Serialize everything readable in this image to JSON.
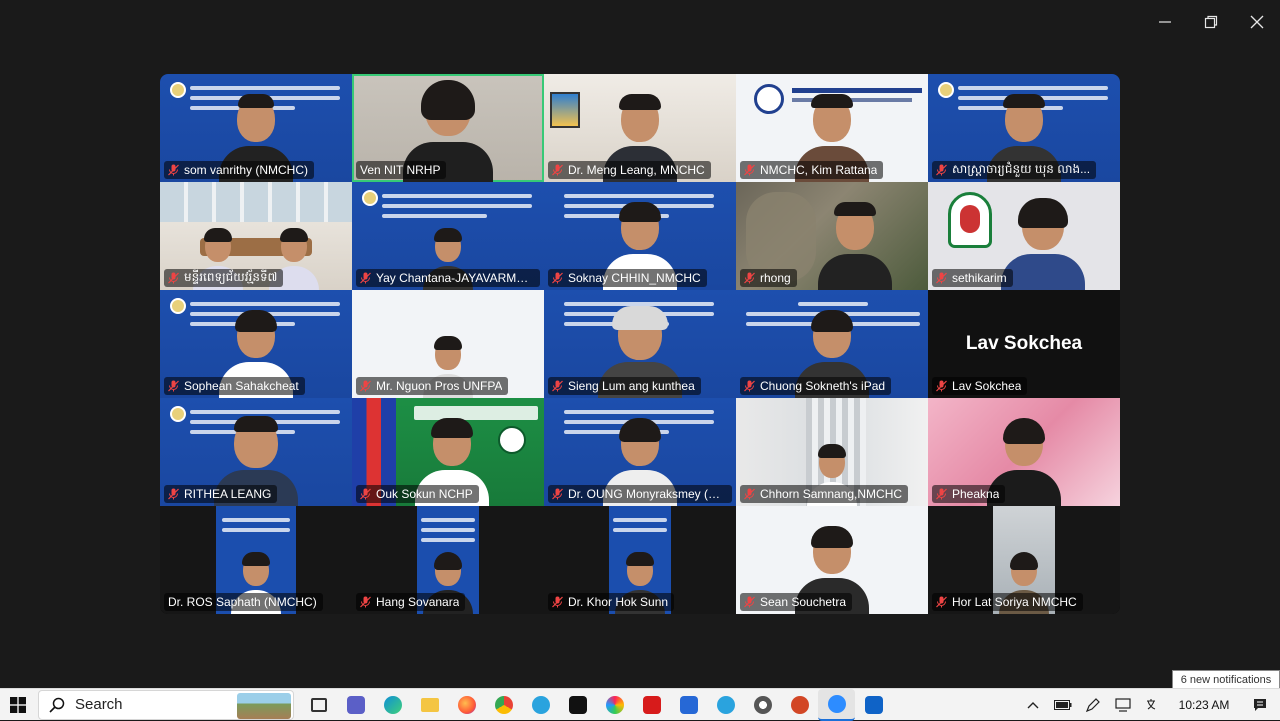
{
  "window": {
    "controls": [
      "minimize",
      "maximize",
      "close"
    ]
  },
  "participants": [
    {
      "name": "som vanrithy (NMCHC)",
      "muted": true,
      "bg": "blue"
    },
    {
      "name": "Ven NIT NRHP",
      "muted": false,
      "bg": "wall",
      "active": true
    },
    {
      "name": "Dr. Meng Leang, MNCHC",
      "muted": true,
      "bg": "room"
    },
    {
      "name": "NMCHC, Kim Rattana",
      "muted": true,
      "bg": "white"
    },
    {
      "name": "សាស្ត្រាចារ្យជំនួយ ឃុន លាង...",
      "muted": true,
      "bg": "blue"
    },
    {
      "name": "មន្ទីរពេទ្យជ័យវរ្ម័នទី៧",
      "muted": true,
      "bg": "room2"
    },
    {
      "name": "Yay Chantana-JAYAVARMAN...",
      "muted": true,
      "bg": "blue"
    },
    {
      "name": "Soknay CHHIN_NMCHC",
      "muted": true,
      "bg": "blue"
    },
    {
      "name": "rhong",
      "muted": true,
      "bg": "temple"
    },
    {
      "name": "sethikarim",
      "muted": true,
      "bg": "grey"
    },
    {
      "name": "Sophean Sahakcheat",
      "muted": true,
      "bg": "blue"
    },
    {
      "name": "Mr. Nguon Pros UNFPA",
      "muted": true,
      "bg": "white"
    },
    {
      "name": "Sieng Lum ang kunthea",
      "muted": true,
      "bg": "blue"
    },
    {
      "name": "Chuong Sokneth's iPad",
      "muted": true,
      "bg": "blue"
    },
    {
      "name": "Lav Sokchea",
      "muted": true,
      "bg": "black",
      "card_text": "Lav Sokchea"
    },
    {
      "name": "RITHEA LEANG",
      "muted": true,
      "bg": "blue"
    },
    {
      "name": "Ouk Sokun NCHP",
      "muted": true,
      "bg": "green"
    },
    {
      "name": "Dr. OUNG Monyraksmey (N...",
      "muted": true,
      "bg": "blue"
    },
    {
      "name": "Chhorn Samnang,NMCHC",
      "muted": true,
      "bg": "office"
    },
    {
      "name": "Pheakna",
      "muted": true,
      "bg": "orchid"
    },
    {
      "name": "Dr. ROS Saphath (NMCHC)",
      "muted": false,
      "bg": "dark-portrait"
    },
    {
      "name": "Hang Sovanara",
      "muted": true,
      "bg": "dark-portrait"
    },
    {
      "name": "Dr. Khor Hok Sunn",
      "muted": true,
      "bg": "dark-portrait"
    },
    {
      "name": "Sean Souchetra",
      "muted": true,
      "bg": "white"
    },
    {
      "name": "Hor Lat Soriya NMCHC",
      "muted": true,
      "bg": "dark-room"
    }
  ],
  "taskbar": {
    "search_placeholder": "Search",
    "apps": [
      "task-view",
      "teams",
      "edge",
      "file-explorer",
      "firefox",
      "chrome",
      "telegram",
      "capcut",
      "paint",
      "acrobat",
      "app-blue",
      "telegram-2",
      "settings",
      "powerpoint",
      "zoom",
      "outlook"
    ],
    "clock": "10:23 AM"
  },
  "notification_toast": "6 new notifications"
}
